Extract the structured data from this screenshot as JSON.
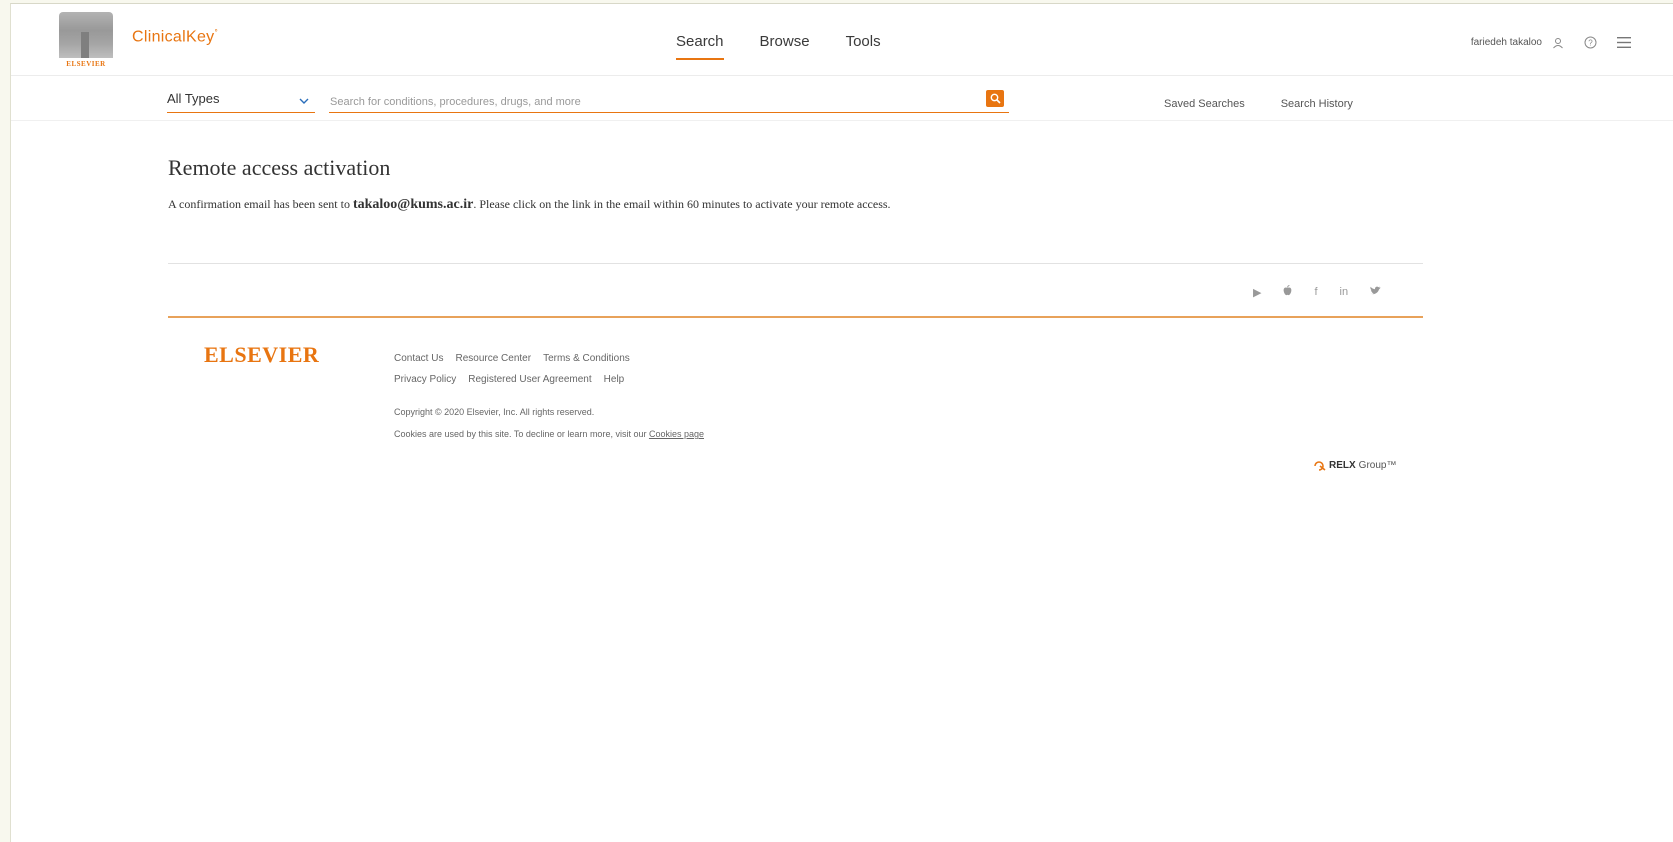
{
  "header": {
    "logo_text": "ELSEVIER",
    "brand": "ClinicalKey",
    "brand_mark": "°",
    "nav": [
      {
        "label": "Search",
        "active": true
      },
      {
        "label": "Browse",
        "active": false
      },
      {
        "label": "Tools",
        "active": false
      }
    ],
    "user_name": "fariedeh takaloo",
    "icons": [
      "user-icon",
      "help-icon",
      "menu-icon"
    ]
  },
  "search": {
    "type_value": "All Types",
    "placeholder": "Search for conditions, procedures, drugs, and more",
    "saved_searches": "Saved Searches",
    "search_history": "Search History"
  },
  "main": {
    "title": "Remote access activation",
    "message_before": "A confirmation email has been sent to ",
    "email": "takaloo@kums.ac.ir",
    "message_after": ". Please click on the link in the email within 60 minutes to activate your remote access."
  },
  "footer": {
    "social": [
      {
        "name": "play-icon",
        "glyph": "▶"
      },
      {
        "name": "apple-icon",
        "glyph": ""
      },
      {
        "name": "facebook-icon",
        "glyph": "f"
      },
      {
        "name": "linkedin-icon",
        "glyph": "in"
      },
      {
        "name": "twitter-icon",
        "glyph": "🐦"
      }
    ],
    "wordmark": "ELSEVIER",
    "links_row1": [
      "Contact Us",
      "Resource Center",
      "Terms & Conditions"
    ],
    "links_row2": [
      "Privacy Policy",
      "Registered User Agreement",
      "Help"
    ],
    "copyright": "Copyright © 2020 Elsevier, Inc. All rights reserved.",
    "cookies_text": "Cookies are used by this site. To decline or learn more, visit our ",
    "cookies_link": "Cookies page",
    "relx_bold": "RELX",
    "relx_rest": " Group™"
  },
  "colors": {
    "accent": "#e87511",
    "background": "#ffffff"
  }
}
